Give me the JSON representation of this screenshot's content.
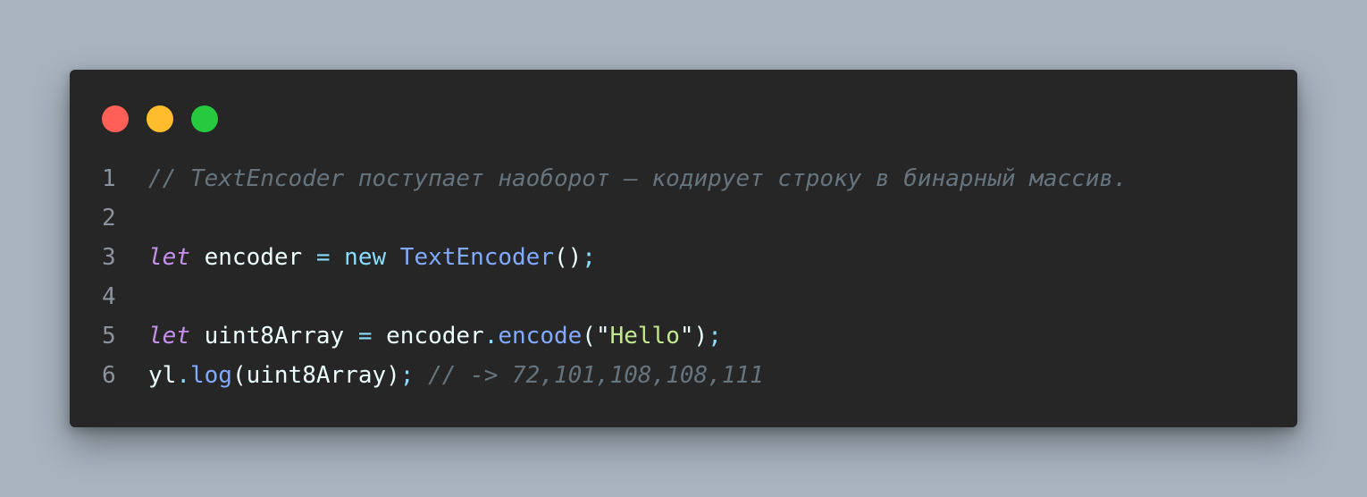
{
  "window": {
    "buttons": [
      {
        "name": "close",
        "color": "#ff5f56"
      },
      {
        "name": "minimize",
        "color": "#ffbd2e"
      },
      {
        "name": "maximize",
        "color": "#27c93f"
      }
    ]
  },
  "code": {
    "lines": [
      {
        "number": "1",
        "tokens": [
          {
            "text": "// TextEncoder поступает наоборот – кодирует строку в бинарный массив.",
            "type": "comment"
          }
        ]
      },
      {
        "number": "2",
        "tokens": []
      },
      {
        "number": "3",
        "tokens": [
          {
            "text": "let",
            "type": "keyword"
          },
          {
            "text": " encoder ",
            "type": "plain"
          },
          {
            "text": "=",
            "type": "op"
          },
          {
            "text": " ",
            "type": "plain"
          },
          {
            "text": "new",
            "type": "op"
          },
          {
            "text": " ",
            "type": "plain"
          },
          {
            "text": "TextEncoder",
            "type": "func"
          },
          {
            "text": "()",
            "type": "paren"
          },
          {
            "text": ";",
            "type": "punct"
          }
        ]
      },
      {
        "number": "4",
        "tokens": []
      },
      {
        "number": "5",
        "tokens": [
          {
            "text": "let",
            "type": "keyword"
          },
          {
            "text": " uint8Array ",
            "type": "plain"
          },
          {
            "text": "=",
            "type": "op"
          },
          {
            "text": " encoder",
            "type": "plain"
          },
          {
            "text": ".",
            "type": "op"
          },
          {
            "text": "encode",
            "type": "func"
          },
          {
            "text": "(",
            "type": "paren"
          },
          {
            "text": "\"",
            "type": "plain"
          },
          {
            "text": "Hello",
            "type": "string"
          },
          {
            "text": "\"",
            "type": "plain"
          },
          {
            "text": ")",
            "type": "paren"
          },
          {
            "text": ";",
            "type": "punct"
          }
        ]
      },
      {
        "number": "6",
        "tokens": [
          {
            "text": "yl",
            "type": "plain"
          },
          {
            "text": ".",
            "type": "op"
          },
          {
            "text": "log",
            "type": "func"
          },
          {
            "text": "(uint8Array)",
            "type": "paren"
          },
          {
            "text": ";",
            "type": "punct"
          },
          {
            "text": " ",
            "type": "plain"
          },
          {
            "text": "// -> 72,101,108,108,111",
            "type": "comment"
          }
        ]
      }
    ]
  }
}
